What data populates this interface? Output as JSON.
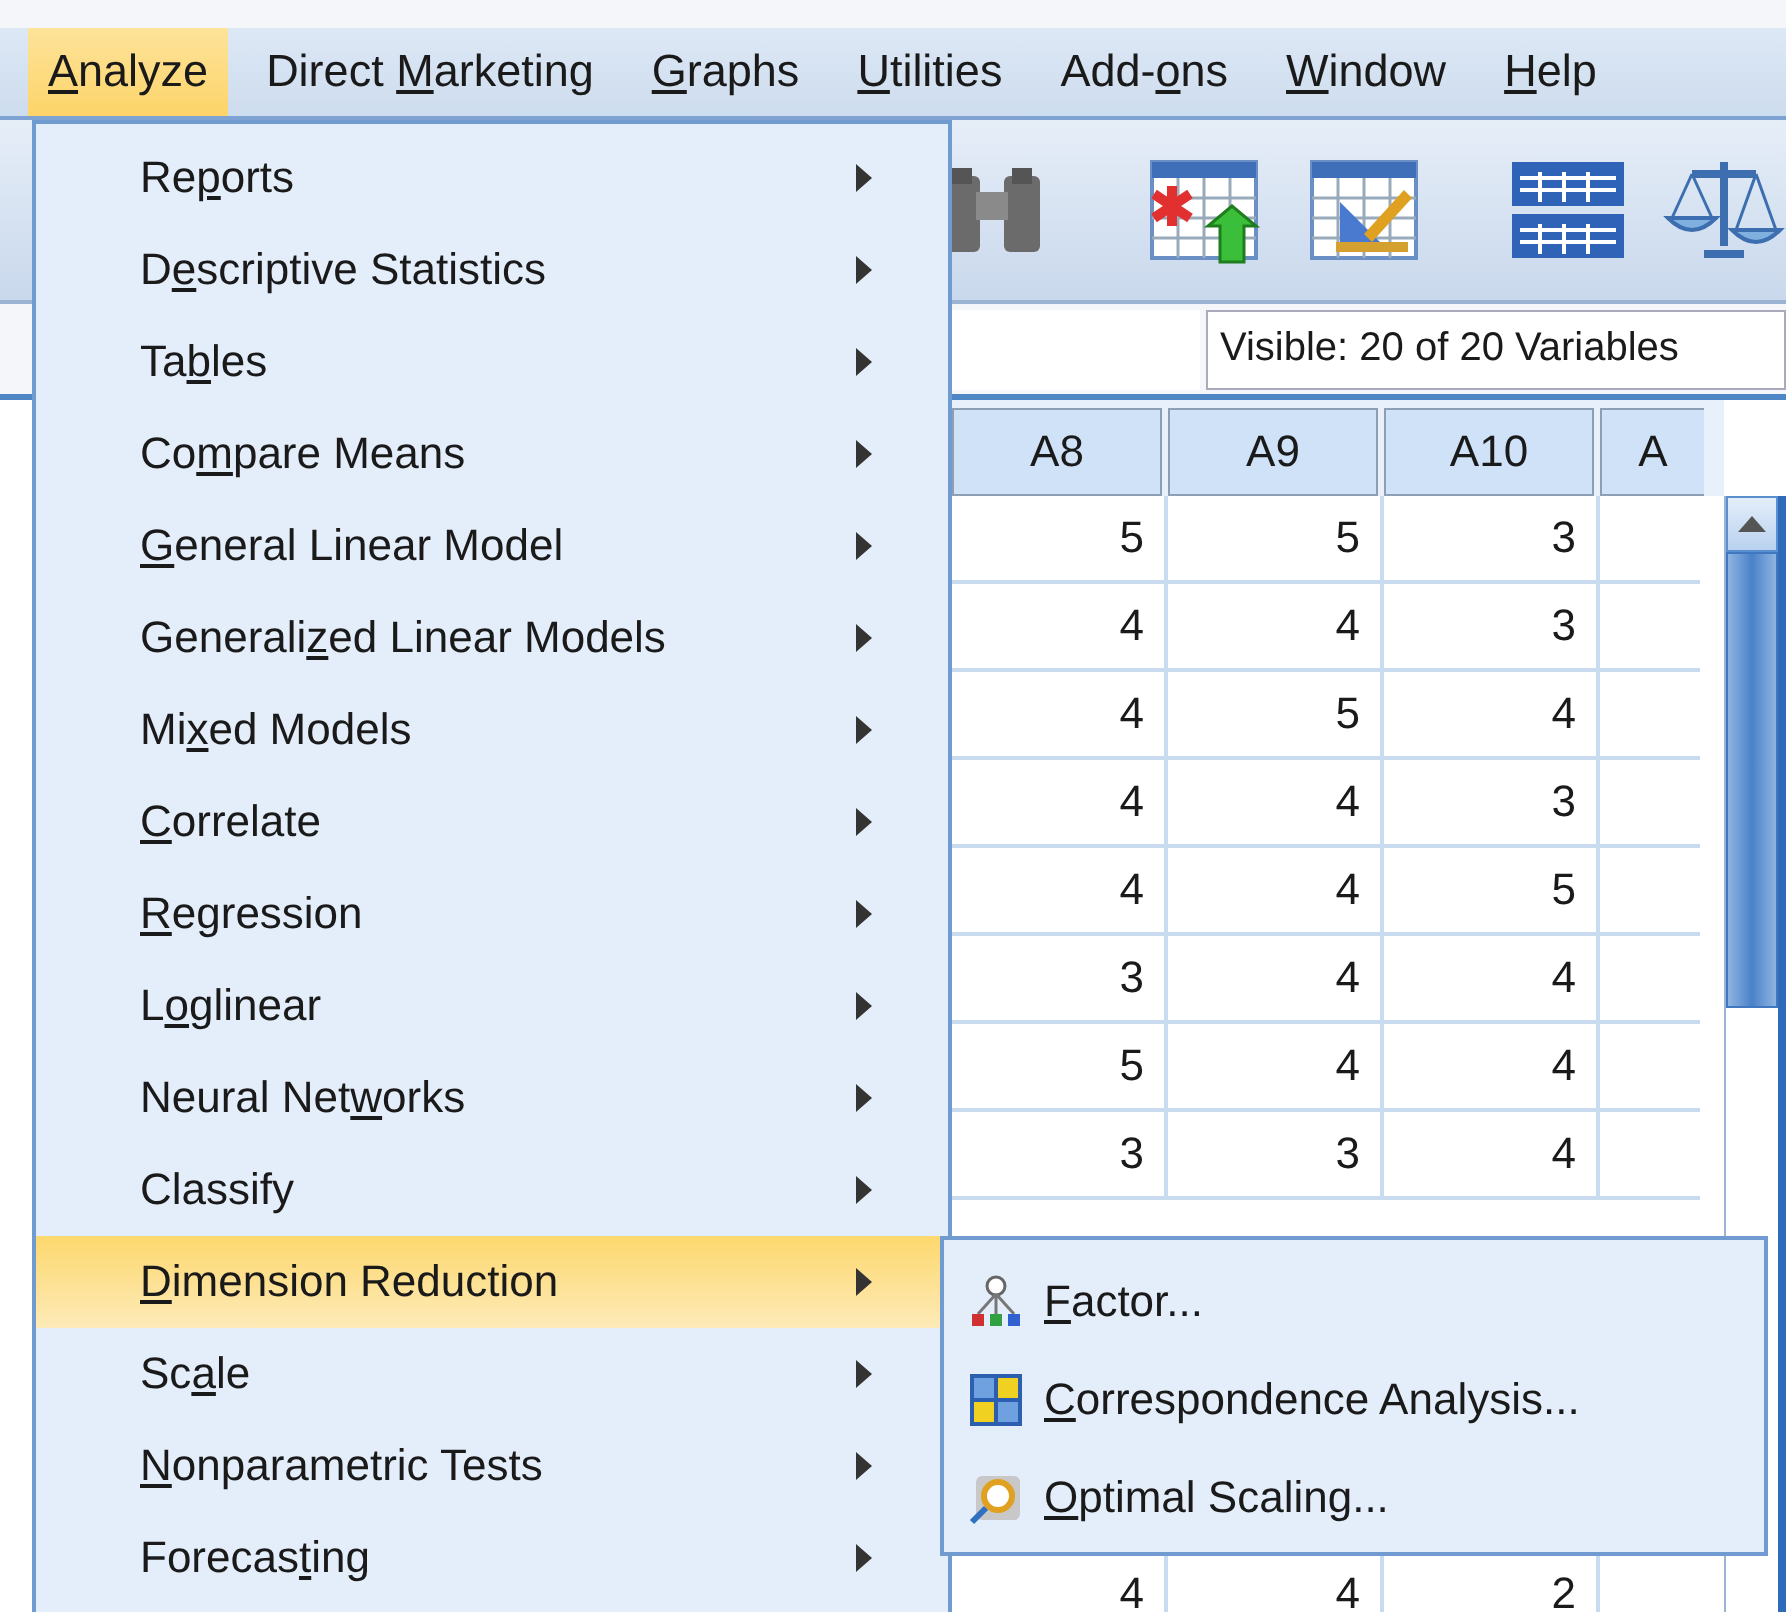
{
  "menubar": [
    {
      "label": [
        {
          "text": "A",
          "underlined": true
        },
        {
          "text": "nalyze",
          "underlined": false
        }
      ],
      "selected": true
    },
    {
      "label": [
        {
          "text": "Direct ",
          "underlined": false
        },
        {
          "text": "M",
          "underlined": true
        },
        {
          "text": "arketing",
          "underlined": false
        }
      ],
      "selected": false
    },
    {
      "label": [
        {
          "text": "G",
          "underlined": true
        },
        {
          "text": "raphs",
          "underlined": false
        }
      ],
      "selected": false
    },
    {
      "label": [
        {
          "text": "U",
          "underlined": true
        },
        {
          "text": "tilities",
          "underlined": false
        }
      ],
      "selected": false
    },
    {
      "label": [
        {
          "text": "Add-",
          "underlined": false
        },
        {
          "text": "o",
          "underlined": true
        },
        {
          "text": "ns",
          "underlined": false
        }
      ],
      "selected": false
    },
    {
      "label": [
        {
          "text": "W",
          "underlined": true
        },
        {
          "text": "indow",
          "underlined": false
        }
      ],
      "selected": false
    },
    {
      "label": [
        {
          "text": "H",
          "underlined": true
        },
        {
          "text": "elp",
          "underlined": false
        }
      ],
      "selected": false
    }
  ],
  "variables_indicator": "Visible: 20 of 20 Variables",
  "grid": {
    "columns": [
      "A8",
      "A9",
      "A10",
      "A"
    ],
    "rows": [
      [
        "5",
        "5",
        "3"
      ],
      [
        "4",
        "4",
        "3"
      ],
      [
        "4",
        "5",
        "4"
      ],
      [
        "4",
        "4",
        "3"
      ],
      [
        "4",
        "4",
        "5"
      ],
      [
        "3",
        "4",
        "4"
      ],
      [
        "5",
        "4",
        "4"
      ],
      [
        "3",
        "3",
        "4"
      ]
    ],
    "last_row": [
      "4",
      "4",
      "2"
    ]
  },
  "analyze_menu": {
    "items": [
      {
        "label": [
          {
            "text": "Re",
            "underlined": false
          },
          {
            "text": "p",
            "underlined": true
          },
          {
            "text": "orts",
            "underlined": false
          }
        ],
        "has_submenu": true,
        "selected": false
      },
      {
        "label": [
          {
            "text": "D",
            "underlined": false
          },
          {
            "text": "e",
            "underlined": true
          },
          {
            "text": "scriptive Statistics",
            "underlined": false
          }
        ],
        "has_submenu": true,
        "selected": false
      },
      {
        "label": [
          {
            "text": "Ta",
            "underlined": false
          },
          {
            "text": "b",
            "underlined": true
          },
          {
            "text": "les",
            "underlined": false
          }
        ],
        "has_submenu": true,
        "selected": false
      },
      {
        "label": [
          {
            "text": "Co",
            "underlined": false
          },
          {
            "text": "m",
            "underlined": true
          },
          {
            "text": "pare Means",
            "underlined": false
          }
        ],
        "has_submenu": true,
        "selected": false
      },
      {
        "label": [
          {
            "text": "G",
            "underlined": true
          },
          {
            "text": "eneral Linear Model",
            "underlined": false
          }
        ],
        "has_submenu": true,
        "selected": false
      },
      {
        "label": [
          {
            "text": "Generali",
            "underlined": false
          },
          {
            "text": "z",
            "underlined": true
          },
          {
            "text": "ed Linear Models",
            "underlined": false
          }
        ],
        "has_submenu": true,
        "selected": false
      },
      {
        "label": [
          {
            "text": "Mi",
            "underlined": false
          },
          {
            "text": "x",
            "underlined": true
          },
          {
            "text": "ed Models",
            "underlined": false
          }
        ],
        "has_submenu": true,
        "selected": false
      },
      {
        "label": [
          {
            "text": "C",
            "underlined": true
          },
          {
            "text": "orrelate",
            "underlined": false
          }
        ],
        "has_submenu": true,
        "selected": false
      },
      {
        "label": [
          {
            "text": "R",
            "underlined": true
          },
          {
            "text": "egression",
            "underlined": false
          }
        ],
        "has_submenu": true,
        "selected": false
      },
      {
        "label": [
          {
            "text": "L",
            "underlined": false
          },
          {
            "text": "o",
            "underlined": true
          },
          {
            "text": "glinear",
            "underlined": false
          }
        ],
        "has_submenu": true,
        "selected": false
      },
      {
        "label": [
          {
            "text": "Neural Net",
            "underlined": false
          },
          {
            "text": "w",
            "underlined": true
          },
          {
            "text": "orks",
            "underlined": false
          }
        ],
        "has_submenu": true,
        "selected": false
      },
      {
        "label": [
          {
            "text": "Classify",
            "underlined": false
          }
        ],
        "has_submenu": true,
        "selected": false
      },
      {
        "label": [
          {
            "text": "D",
            "underlined": true
          },
          {
            "text": "imension Reduction",
            "underlined": false
          }
        ],
        "has_submenu": true,
        "selected": true
      },
      {
        "label": [
          {
            "text": "Sc",
            "underlined": false
          },
          {
            "text": "a",
            "underlined": true
          },
          {
            "text": "le",
            "underlined": false
          }
        ],
        "has_submenu": true,
        "selected": false
      },
      {
        "label": [
          {
            "text": "N",
            "underlined": true
          },
          {
            "text": "onparametric Tests",
            "underlined": false
          }
        ],
        "has_submenu": true,
        "selected": false
      },
      {
        "label": [
          {
            "text": "Forecas",
            "underlined": false
          },
          {
            "text": "t",
            "underlined": true
          },
          {
            "text": "ing",
            "underlined": false
          }
        ],
        "has_submenu": true,
        "selected": false
      }
    ]
  },
  "submenu": {
    "items": [
      {
        "label": [
          {
            "text": "F",
            "underlined": true
          },
          {
            "text": "actor...",
            "underlined": false
          }
        ]
      },
      {
        "label": [
          {
            "text": "C",
            "underlined": true
          },
          {
            "text": "orrespondence Analysis...",
            "underlined": false
          }
        ]
      },
      {
        "label": [
          {
            "text": "O",
            "underlined": true
          },
          {
            "text": "ptimal Scaling...",
            "underlined": false
          }
        ]
      }
    ]
  }
}
